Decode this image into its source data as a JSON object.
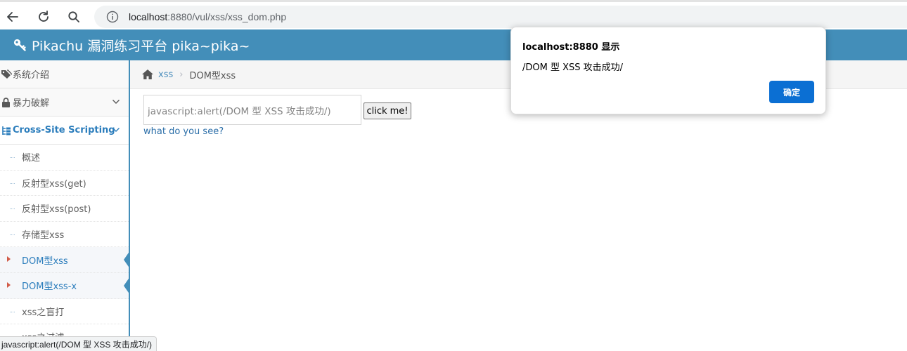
{
  "browser": {
    "url_host": "localhost",
    "url_rest": ":8880/vul/xss/xss_dom.php",
    "status_text": "javascript:alert(/DOM 型 XSS 攻击成功/)"
  },
  "header": {
    "title": "Pikachu 漏洞练习平台 pika~pika~",
    "bg_color": "#438eb9"
  },
  "sidebar": {
    "items": [
      {
        "label": "系统介绍",
        "icon": "tags-icon"
      },
      {
        "label": "暴力破解",
        "icon": "lock-icon"
      },
      {
        "label": "Cross-Site Scripting",
        "icon": "sitemap-icon",
        "open": true
      }
    ],
    "subitems": [
      {
        "label": "概述"
      },
      {
        "label": "反射型xss(get)"
      },
      {
        "label": "反射型xss(post)"
      },
      {
        "label": "存储型xss"
      },
      {
        "label": "DOM型xss",
        "active": true
      },
      {
        "label": "DOM型xss-x",
        "active": true
      },
      {
        "label": "xss之盲打"
      },
      {
        "label": "xss之过滤"
      }
    ]
  },
  "breadcrumb": {
    "parent": "xss",
    "current": "DOM型xss"
  },
  "main": {
    "input_value": "javascript:alert(/DOM 型 XSS 攻击成功/)",
    "button_label": "click me!",
    "link_text": "what do you see?"
  },
  "dialog": {
    "title": "localhost:8880 显示",
    "message": "/DOM 型 XSS 攻击成功/",
    "ok_label": "确定"
  }
}
